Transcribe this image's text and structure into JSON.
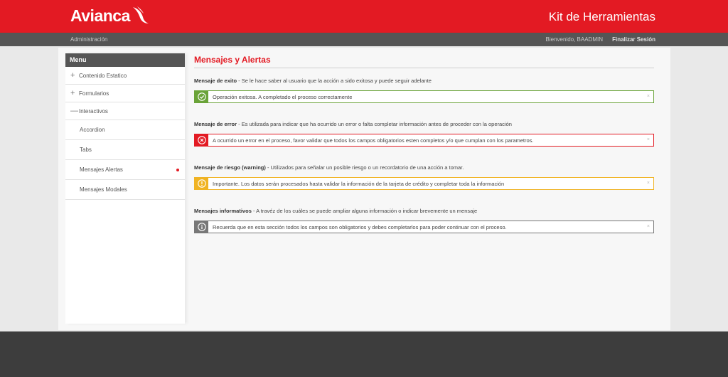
{
  "header": {
    "logo": "Avianca",
    "title": "Kit de Herramientas"
  },
  "subbar": {
    "section": "Administración",
    "welcome": "Bienvenido, BAADMIN",
    "logout": "Finalizar Sesión"
  },
  "menu": {
    "title": "Menu",
    "items": [
      {
        "symbol": "+",
        "label": "Contenido Estatico"
      },
      {
        "symbol": "+",
        "label": "Formularios"
      },
      {
        "symbol": "—",
        "label": "Interactivos"
      }
    ],
    "subitems": [
      "Accordion",
      "Tabs",
      "Mensajes Alertas",
      "Mensajes Modales"
    ],
    "active_subitem": "Mensajes Alertas"
  },
  "main": {
    "title": "Mensajes y Alertas",
    "sections": {
      "success": {
        "label": "Mensaje de exito",
        "desc": " - Se le hace saber al usuario que la acción a sido exitosa y puede seguir adelante",
        "alert": "Operación exitosa. A completado el proceso correctamente",
        "icon": "check-icon"
      },
      "error": {
        "label": "Mensaje de error",
        "desc": " - Es utilizada para indicar que ha ocurrido un error o falta completar información antes de proceder con la operación",
        "alert": "A ocurrido un error en el proceso, favor validar que todos los campos obligatorios esten completos y/o que cumplan con los parametros.",
        "icon": "error-x-icon"
      },
      "warning": {
        "label": "Mensaje de riesgo (warning)",
        "desc": " - Utilizados para señalar un posible riesgo o un recordatorio de una acción a tomar.",
        "alert": "Importante. Los datos serán procesados hasta validar la información de la tarjeta de crédito y completar toda la información",
        "icon": "warning-icon"
      },
      "info": {
        "label": "Mensajes informativos",
        "desc": " - A travéz de los cuáles se puede ampliar alguna información o indicar brevemente un mensaje",
        "alert": "Recuerda que en esta sección todos los campos son obligatorios y debes completarlos para poder continuar con el proceso.",
        "icon": "info-icon"
      }
    },
    "close_glyph": "×"
  },
  "colors": {
    "brand_red": "#e31a23",
    "success": "#6aa338",
    "warning": "#f0b323",
    "info": "#777777",
    "subbar": "#555555",
    "footer": "#3d3d3d"
  }
}
